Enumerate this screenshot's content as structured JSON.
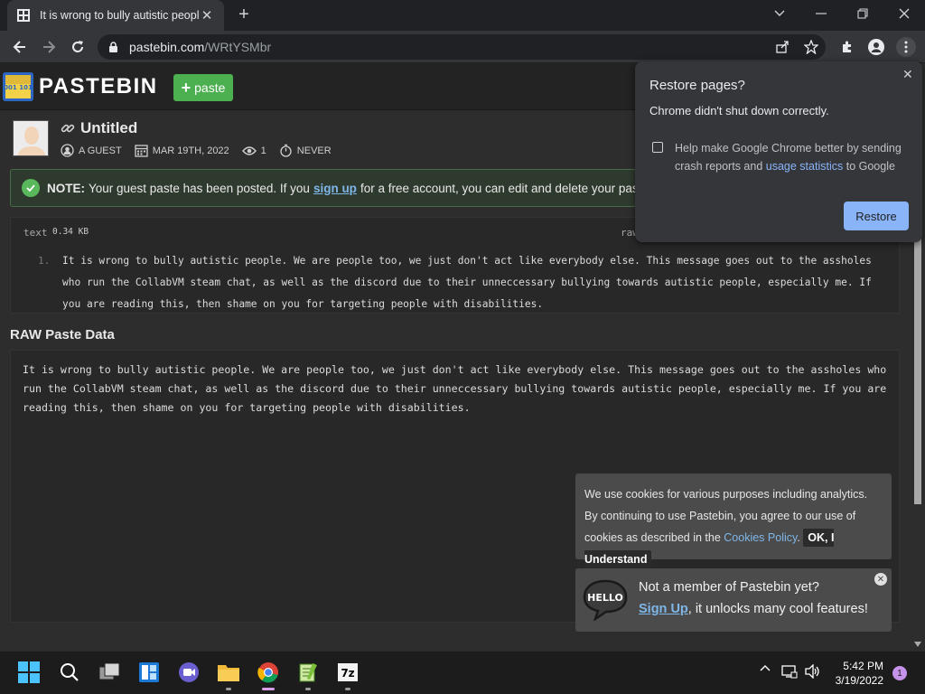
{
  "browser": {
    "tab_title": "It is wrong to bully autistic people!",
    "url_host": "pastebin.com",
    "url_path": "/WRtYSMbr"
  },
  "site": {
    "logo_text": "PASTEBIN",
    "logo_badge": "1001 1011",
    "paste_button": "paste"
  },
  "paste": {
    "title": "Untitled",
    "author": "A GUEST",
    "date": "MAR 19TH, 2022",
    "views": "1",
    "expiry": "NEVER",
    "notice_label": "NOTE:",
    "notice_pre": "Your guest paste has been posted. If you",
    "notice_link": "sign up",
    "notice_post": "for a free account, you can edit and delete your pastes!",
    "lang": "text",
    "size": "0.34 KB",
    "raw_link": "raw",
    "line_number": "1.",
    "content": "It is wrong to bully autistic people. We are people too, we just don't act like everybody else. This message goes out to the assholes who run the CollabVM steam chat, as well as the discord due to their unneccessary bullying towards autistic people, especially me. If you are reading this, then shame on you for targeting people with disabilities.",
    "raw_heading": "RAW Paste Data"
  },
  "restore_popup": {
    "title": "Restore pages?",
    "subtitle": "Chrome didn't shut down correctly.",
    "help_pre": "Help make Google Chrome better by sending crash reports and",
    "help_link": "usage statistics",
    "help_post": "to Google",
    "button": "Restore"
  },
  "cookie_popup": {
    "text": "We use cookies for various purposes including analytics. By continuing to use Pastebin, you agree to our use of cookies as described in the",
    "link": "Cookies Policy",
    "button": "OK, I Understand"
  },
  "hello_popup": {
    "logo_text": "HELLO",
    "line1": "Not a member of Pastebin yet?",
    "link": "Sign Up",
    "line2_post": ", it unlocks many cool features!"
  },
  "taskbar": {
    "time": "5:42 PM",
    "date": "3/19/2022",
    "notification_count": "1",
    "archive_label": "7z"
  },
  "colors": {
    "accent_green": "#4caf50",
    "link_blue": "#7fb6e8",
    "chrome_blue": "#8ab4f8"
  }
}
